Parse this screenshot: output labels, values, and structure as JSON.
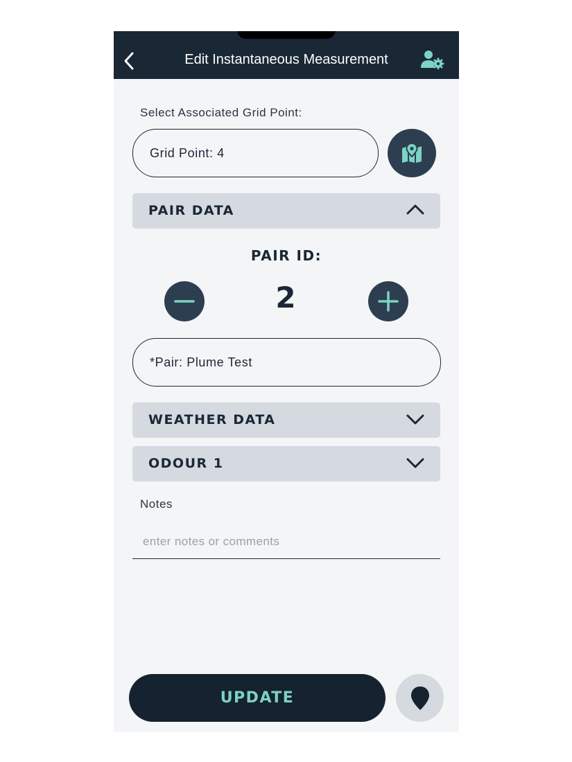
{
  "header": {
    "title": "Edit Instantaneous Measurement",
    "back_icon": "chevron-left-icon",
    "settings_icon": "user-cog-icon"
  },
  "grid_point": {
    "label": "Select Associated Grid Point:",
    "value": "Grid Point: 4",
    "map_icon": "map-pin-icon"
  },
  "sections": {
    "pair_data": {
      "title": "PAIR DATA",
      "expanded": true
    },
    "weather_data": {
      "title": "WEATHER DATA",
      "expanded": false
    },
    "odour_1": {
      "title": "ODOUR 1",
      "expanded": false
    }
  },
  "pair": {
    "id_label": "PAIR ID:",
    "id_value": "2",
    "pair_field": "*Pair: Plume Test"
  },
  "notes": {
    "label": "Notes",
    "placeholder": "enter notes or comments",
    "value": ""
  },
  "actions": {
    "update_label": "UPDATE",
    "location_icon": "location-pin-icon"
  },
  "colors": {
    "header_bg": "#1a2735",
    "accent": "#7dd3c3",
    "section_bg": "#d5d9e0",
    "page_bg": "#f3f5f7"
  }
}
